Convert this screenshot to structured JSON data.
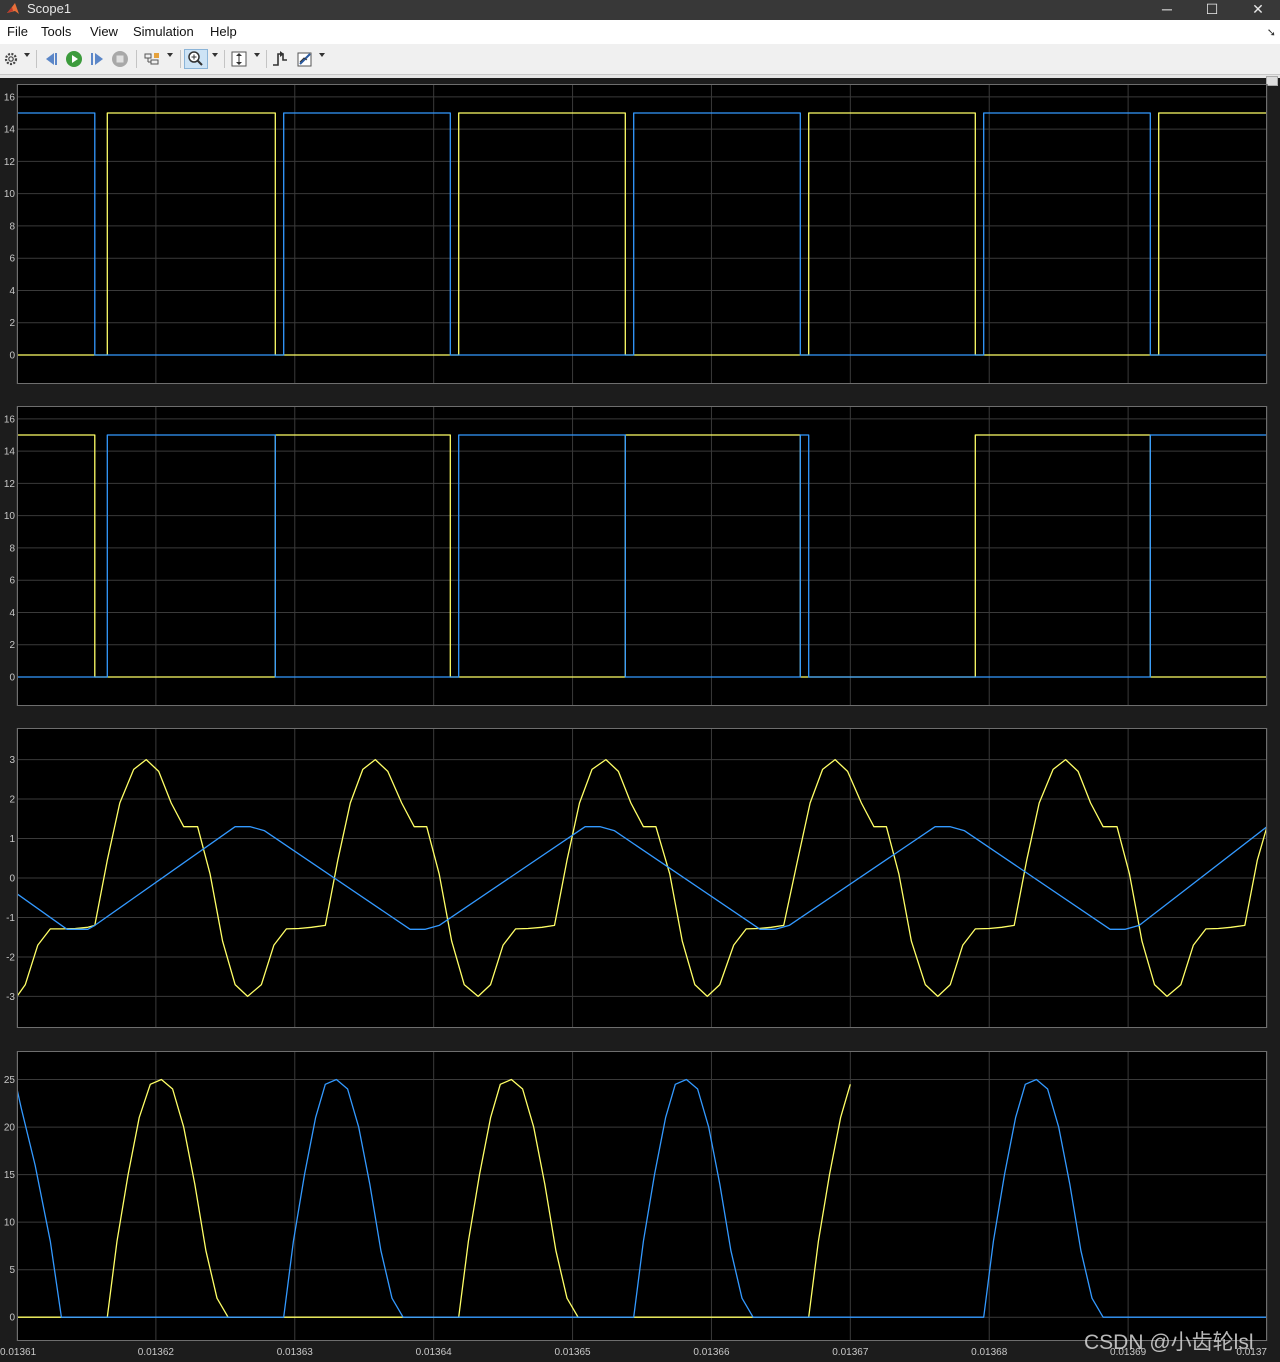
{
  "window": {
    "title": "Scope1",
    "buttons": [
      "─",
      "☐",
      "✕"
    ]
  },
  "menu": {
    "items": [
      "File",
      "Tools",
      "View",
      "Simulation",
      "Help"
    ]
  },
  "toolbar": {
    "icons": [
      "gear-icon",
      "step-back-icon",
      "run-icon",
      "step-forward-icon",
      "stop-icon",
      "highlight-icon",
      "zoom-icon",
      "autoscale-icon",
      "triggers-icon",
      "measure-icon"
    ]
  },
  "colors": {
    "background": "#000000",
    "grid": "#3a3a3a",
    "series_yellow": "#ffff66",
    "series_blue": "#3399ff"
  },
  "watermark": "CSDN @小齿轮lsl",
  "chart_data": [
    {
      "type": "line",
      "xlim": [
        0.01361,
        0.0137
      ],
      "ylim": [
        -1.8,
        16.8
      ],
      "yticks": [
        0,
        2,
        4,
        6,
        8,
        10,
        12,
        14,
        16
      ],
      "ytick_labels": [
        "0",
        "2",
        "4",
        "6",
        "8",
        "10",
        "12",
        "14",
        "16"
      ],
      "grid": true,
      "series": [
        {
          "color": "yellow",
          "x": [
            0.01361,
            0.013616,
            0.013616,
            0.0136165,
            0.0136165,
            0.0136286,
            0.0136286,
            0.0136292,
            0.0136292,
            0.0136412,
            0.0136412,
            0.0136418,
            0.0136418,
            0.0136538,
            0.0136538,
            0.0136544,
            0.0136544,
            0.0136664,
            0.0136664,
            0.013667,
            0.013667,
            0.013679,
            0.013679,
            0.0136796,
            0.0136796,
            0.0136916,
            0.0136916,
            0.0136922,
            0.0136922,
            0.0137
          ],
          "y": [
            0,
            0,
            0,
            0,
            15,
            15,
            0,
            0,
            0,
            0,
            0,
            0,
            15,
            15,
            0,
            0,
            0,
            0,
            0,
            0,
            15,
            15,
            0,
            0,
            0,
            0,
            0,
            0,
            15,
            15
          ]
        },
        {
          "color": "blue",
          "x": [
            0.01361,
            0.0136156,
            0.0136156,
            0.0136165,
            0.0136165,
            0.0136286,
            0.0136286,
            0.0136292,
            0.0136292,
            0.0136412,
            0.0136412,
            0.0136418,
            0.0136418,
            0.0136538,
            0.0136538,
            0.0136544,
            0.0136544,
            0.0136664,
            0.0136664,
            0.013667,
            0.013667,
            0.013679,
            0.013679,
            0.0136796,
            0.0136796,
            0.0136916,
            0.0136916,
            0.0137
          ],
          "y": [
            15,
            15,
            0,
            0,
            0,
            0,
            0,
            0,
            15,
            15,
            0,
            0,
            0,
            0,
            0,
            0,
            15,
            15,
            0,
            0,
            0,
            0,
            0,
            0,
            15,
            15,
            0,
            0
          ]
        }
      ]
    },
    {
      "type": "line",
      "xlim": [
        0.01361,
        0.0137
      ],
      "ylim": [
        -1.8,
        16.8
      ],
      "yticks": [
        0,
        2,
        4,
        6,
        8,
        10,
        12,
        14,
        16
      ],
      "ytick_labels": [
        "0",
        "2",
        "4",
        "6",
        "8",
        "10",
        "12",
        "14",
        "16"
      ],
      "grid": true,
      "series": [
        {
          "color": "yellow",
          "x": [
            0.01361,
            0.0136156,
            0.0136156,
            0.0136165,
            0.0136165,
            0.0136286,
            0.0136286,
            0.0136292,
            0.0136292,
            0.0136412,
            0.0136412,
            0.0136418,
            0.0136418,
            0.0136538,
            0.0136538,
            0.0136544,
            0.0136544,
            0.0136664,
            0.0136664,
            0.013667,
            0.013667,
            0.013679,
            0.013679,
            0.0136796,
            0.0136796,
            0.0136916,
            0.0136916,
            0.0137
          ],
          "y": [
            15,
            15,
            0,
            0,
            0,
            0,
            15,
            15,
            15,
            15,
            0,
            0,
            0,
            0,
            15,
            15,
            15,
            15,
            0,
            0,
            0,
            0,
            15,
            15,
            15,
            15,
            0,
            0
          ]
        },
        {
          "color": "blue",
          "x": [
            0.01361,
            0.0136165,
            0.0136165,
            0.0136286,
            0.0136286,
            0.0136292,
            0.0136292,
            0.0136412,
            0.0136412,
            0.0136418,
            0.0136418,
            0.0136538,
            0.0136538,
            0.0136544,
            0.0136544,
            0.0136664,
            0.0136664,
            0.013667,
            0.013667,
            0.013679,
            0.013679,
            0.0136796,
            0.0136796,
            0.0136916,
            0.0136916,
            0.0137
          ],
          "y": [
            0,
            0,
            15,
            15,
            0,
            0,
            0,
            0,
            0,
            0,
            15,
            15,
            0,
            0,
            0,
            0,
            15,
            15,
            0,
            0,
            0,
            0,
            0,
            0,
            15,
            15
          ]
        }
      ]
    },
    {
      "type": "line",
      "xlim": [
        0.01361,
        0.0137
      ],
      "ylim": [
        -3.8,
        3.8
      ],
      "yticks": [
        -3,
        -2,
        -1,
        0,
        1,
        2,
        3
      ],
      "ytick_labels": [
        "-3",
        "-2",
        "-1",
        "0",
        "1",
        "2",
        "3"
      ],
      "grid": true,
      "series": [
        {
          "color": "yellow",
          "x": [
            0.01361,
            0.0136106,
            0.0136115,
            0.0136124,
            0.0136133,
            0.0136142,
            0.0136151,
            0.0136156,
            0.0136165,
            0.0136174,
            0.0136184,
            0.0136193,
            0.0136202,
            0.0136211,
            0.013622,
            0.013623,
            0.0136239,
            0.0136248,
            0.0136257,
            0.0136266,
            0.0136276,
            0.0136285,
            0.0136294,
            0.0136303,
            0.0136312,
            0.0136322,
            0.0136331,
            0.013634,
            0.0136349,
            0.0136358,
            0.0136367,
            0.0136377,
            0.0136386,
            0.0136395,
            0.0136404,
            0.0136413,
            0.0136422,
            0.0136432,
            0.0136441,
            0.013645,
            0.0136459,
            0.0136468,
            0.0136478,
            0.0136487,
            0.0136496,
            0.0136505,
            0.0136514,
            0.0136524,
            0.0136533,
            0.0136542,
            0.0136551,
            0.013656,
            0.013657,
            0.0136579,
            0.0136588,
            0.0136597,
            0.0136606,
            0.0136616,
            0.0136625,
            0.0136634,
            0.0136643,
            0.0136652,
            0.0136662,
            0.0136671,
            0.013668,
            0.0136689,
            0.0136698,
            0.0136708,
            0.0136717,
            0.0136726,
            0.0136735,
            0.0136744,
            0.0136754,
            0.0136763,
            0.0136772,
            0.0136781,
            0.013679,
            0.01368,
            0.0136809,
            0.0136818,
            0.0136827,
            0.0136836,
            0.0136846,
            0.0136855,
            0.0136864,
            0.0136873,
            0.0136882,
            0.0136892,
            0.0136901,
            0.013691,
            0.0136919,
            0.0136928,
            0.0136938,
            0.0136947,
            0.0136956,
            0.0136965,
            0.0136974,
            0.0136984,
            0.0136993,
            0.0137
          ],
          "y": [
            -3.0,
            -2.7,
            -1.7,
            -1.29,
            -1.29,
            -1.28,
            -1.25,
            -1.2,
            0.45,
            1.9,
            2.75,
            3.0,
            2.7,
            1.9,
            1.3,
            1.3,
            0.1,
            -1.6,
            -2.7,
            -3.0,
            -2.7,
            -1.7,
            -1.29,
            -1.28,
            -1.25,
            -1.2,
            0.45,
            1.9,
            2.75,
            3.0,
            2.7,
            1.9,
            1.3,
            1.3,
            0.1,
            -1.6,
            -2.7,
            -3.0,
            -2.7,
            -1.7,
            -1.29,
            -1.28,
            -1.25,
            -1.2,
            0.45,
            1.9,
            2.75,
            3.0,
            2.7,
            1.9,
            1.3,
            1.3,
            0.1,
            -1.6,
            -2.7,
            -3.0,
            -2.7,
            -1.7,
            -1.29,
            -1.28,
            -1.25,
            -1.2,
            0.45,
            1.9,
            2.75,
            3.0,
            2.7,
            1.9,
            1.3,
            1.3,
            0.1,
            -1.6,
            -2.7,
            -3.0,
            -2.7,
            -1.7,
            -1.29,
            -1.28,
            -1.25,
            -1.2,
            0.45,
            1.9,
            2.75,
            3.0,
            2.7,
            1.9,
            1.3,
            1.3,
            0.1,
            -1.6,
            -2.7,
            -3.0,
            -2.7,
            -1.7,
            -1.29,
            -1.28,
            -1.25,
            -1.2,
            0.45,
            1.3
          ]
        },
        {
          "color": "blue",
          "x": [
            0.01361,
            0.0136136,
            0.0136142,
            0.0136151,
            0.0136156,
            0.0136257,
            0.0136268,
            0.0136278,
            0.0136383,
            0.0136394,
            0.0136404,
            0.0136509,
            0.013652,
            0.013653,
            0.0136635,
            0.0136646,
            0.0136656,
            0.0136761,
            0.0136772,
            0.0136782,
            0.0136887,
            0.0136898,
            0.0136908,
            0.0137
          ],
          "y": [
            -0.4,
            -1.3,
            -1.3,
            -1.3,
            -1.2,
            1.3,
            1.3,
            1.2,
            -1.3,
            -1.3,
            -1.2,
            1.3,
            1.3,
            1.2,
            -1.3,
            -1.3,
            -1.2,
            1.3,
            1.3,
            1.2,
            -1.3,
            -1.3,
            -1.2,
            1.3
          ]
        }
      ]
    },
    {
      "type": "line",
      "xlim": [
        0.01361,
        0.0137
      ],
      "ylim": [
        -2.5,
        28.0
      ],
      "yticks": [
        0,
        5,
        10,
        15,
        20,
        25
      ],
      "ytick_labels": [
        "0",
        "5",
        "10",
        "15",
        "20",
        "25"
      ],
      "grid": true,
      "x_tick_labels": [
        "0.01361",
        "0.01362",
        "0.01363",
        "0.01364",
        "0.01365",
        "0.01366",
        "0.01367",
        "0.01368",
        "0.01369",
        "0.0137"
      ],
      "series": [
        {
          "color": "yellow",
          "x": [
            0.01361,
            0.0136165,
            0.0136172,
            0.013618,
            0.0136188,
            0.0136196,
            0.0136204,
            0.0136212,
            0.013622,
            0.0136228,
            0.0136236,
            0.0136244,
            0.0136252,
            0.0136255,
            0.0136292,
            0.0136299,
            0.0136307,
            0.0136315,
            0.0136322,
            0.013633,
            0.0136338,
            0.0136346,
            0.0136354,
            0.0136362,
            0.013637,
            0.0136378,
            0.0136381,
            0.0136418,
            0.0136425,
            0.0136433,
            0.0136441,
            0.0136448,
            0.0136456,
            0.0136464,
            0.0136472,
            0.013648,
            0.0136488,
            0.0136496,
            0.0136504,
            0.0136507,
            0.0136544,
            0.0136551,
            0.0136559,
            0.0136567,
            0.0136574,
            0.0136582,
            0.013659,
            0.0136598,
            0.0136606,
            0.0136614,
            0.0136622,
            0.013663,
            0.0136633,
            0.013667,
            0.0136677,
            0.0136685,
            0.0136693,
            0.01367
          ],
          "y": [
            0,
            0,
            8,
            15,
            21,
            24.5,
            25,
            24,
            20,
            14,
            7,
            2,
            0,
            0,
            0,
            0,
            0,
            0,
            0,
            0,
            0,
            0,
            0,
            0,
            0,
            0,
            0,
            0,
            8,
            15,
            21,
            24.5,
            25,
            24,
            20,
            14,
            7,
            2,
            0,
            0,
            0,
            0,
            0,
            0,
            0,
            0,
            0,
            0,
            0,
            0,
            0,
            0,
            0,
            0,
            8,
            15,
            21,
            24.5
          ]
        },
        {
          "color": "blue",
          "x": [
            0.01361,
            0.0136103,
            0.0136113,
            0.0136124,
            0.0136132,
            0.0136165,
            0.0136292,
            0.0136299,
            0.0136307,
            0.0136315,
            0.0136322,
            0.013633,
            0.0136338,
            0.0136346,
            0.0136354,
            0.0136362,
            0.013637,
            0.0136378,
            0.0136381,
            0.0136418,
            0.0136544,
            0.0136551,
            0.0136559,
            0.0136567,
            0.0136574,
            0.0136582,
            0.013659,
            0.0136598,
            0.0136606,
            0.0136614,
            0.0136622,
            0.013663,
            0.0136633,
            0.013667,
            0.0136796,
            0.0136803,
            0.0136811,
            0.0136819,
            0.0136826,
            0.0136834,
            0.0136842,
            0.013685,
            0.0136858,
            0.0136866,
            0.0136874,
            0.0136882,
            0.0136885,
            0.0137
          ],
          "y": [
            24,
            22,
            16,
            8,
            0,
            0,
            0,
            8,
            15,
            21,
            24.5,
            25,
            24,
            20,
            14,
            7,
            2,
            0,
            0,
            0,
            0,
            8,
            15,
            21,
            24.5,
            25,
            24,
            20,
            14,
            7,
            2,
            0,
            0,
            0,
            0,
            8,
            15,
            21,
            24.5,
            25,
            24,
            20,
            14,
            7,
            2,
            0,
            0,
            0
          ]
        }
      ]
    }
  ]
}
